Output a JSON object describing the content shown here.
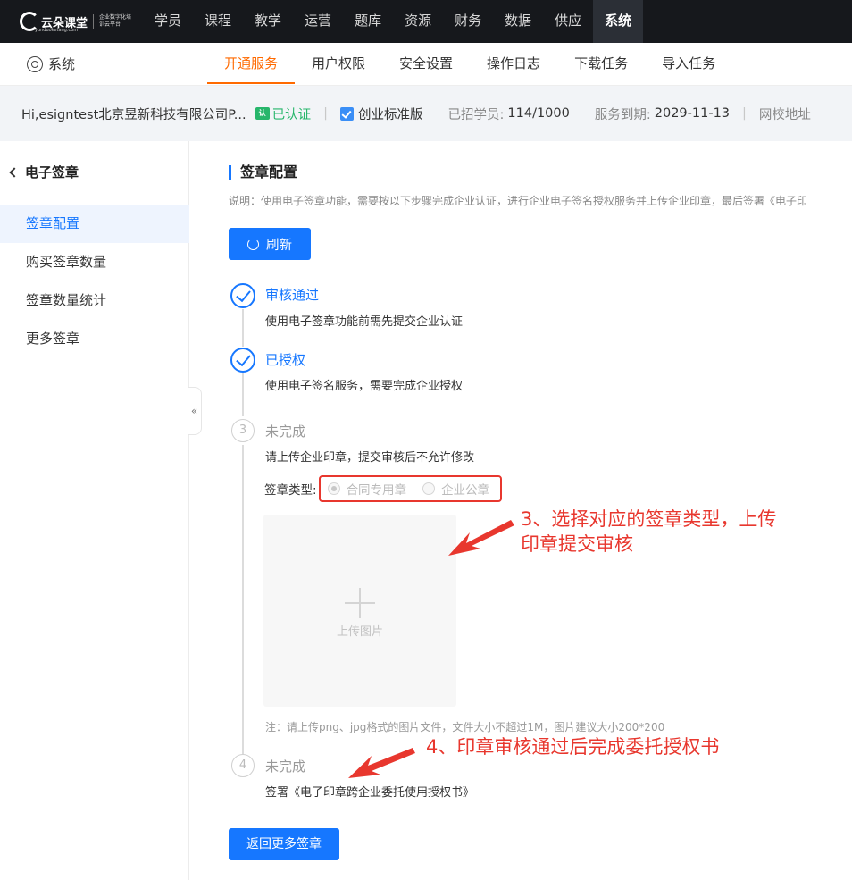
{
  "topnav": {
    "logo_text": "云朵课堂",
    "logo_url": "yunduoketang.com",
    "logo_sub": "企业数字化培训云平台",
    "items": [
      "学员",
      "课程",
      "教学",
      "运营",
      "题库",
      "资源",
      "财务",
      "数据",
      "供应",
      "系统"
    ],
    "active_index": 9
  },
  "subnav": {
    "section_label": "系统",
    "section_icon": "gear-icon",
    "tabs": [
      "开通服务",
      "用户权限",
      "安全设置",
      "操作日志",
      "下载任务",
      "导入任务"
    ],
    "active_index": 0
  },
  "infobar": {
    "greeting": "Hi,esigntest北京昱新科技有限公司P...",
    "cert_icon_text": "认",
    "cert_text": "已认证",
    "edition": "创业标准版",
    "students_label": "已招学员:",
    "students_value": "114/1000",
    "expire_label": "服务到期:",
    "expire_value": "2029-11-13",
    "site_label": "网校地址"
  },
  "sidebar": {
    "back_label": "电子签章",
    "items": [
      "签章配置",
      "购买签章数量",
      "签章数量统计",
      "更多签章"
    ],
    "active_index": 0,
    "collapse_label": "«"
  },
  "main": {
    "title": "签章配置",
    "desc": "说明：使用电子签章功能，需要按以下步骤完成企业认证，进行企业电子签名授权服务并上传企业印章，最后签署《电子印",
    "refresh_label": "刷新",
    "steps": [
      {
        "status": "done",
        "title": "审核通过",
        "desc": "使用电子签章功能前需先提交企业认证"
      },
      {
        "status": "done",
        "title": "已授权",
        "desc": "使用电子签名服务，需要完成企业授权"
      },
      {
        "status": "todo",
        "num": "3",
        "title": "未完成",
        "desc": "请上传企业印章，提交审核后不允许修改"
      },
      {
        "status": "todo",
        "num": "4",
        "title": "未完成",
        "desc": "签署《电子印章跨企业委托使用授权书》"
      }
    ],
    "seal_type_label": "签章类型:",
    "seal_options": [
      "合同专用章",
      "企业公章"
    ],
    "seal_selected_index": 0,
    "upload_label": "上传图片",
    "upload_note": "注：请上传png、jpg格式的图片文件，文件大小不超过1M，图片建议大小200*200",
    "back_button": "返回更多签章"
  },
  "annotations": {
    "step3_line1": "3、选择对应的签章类型，上传",
    "step3_line2": "印章提交审核",
    "step4": "4、印章审核通过后完成委托授权书",
    "color": "#e8372e"
  },
  "colors": {
    "primary": "#1677ff",
    "tab_active": "#ff6a00",
    "cert": "#27b66b",
    "annotation": "#e8372e"
  }
}
